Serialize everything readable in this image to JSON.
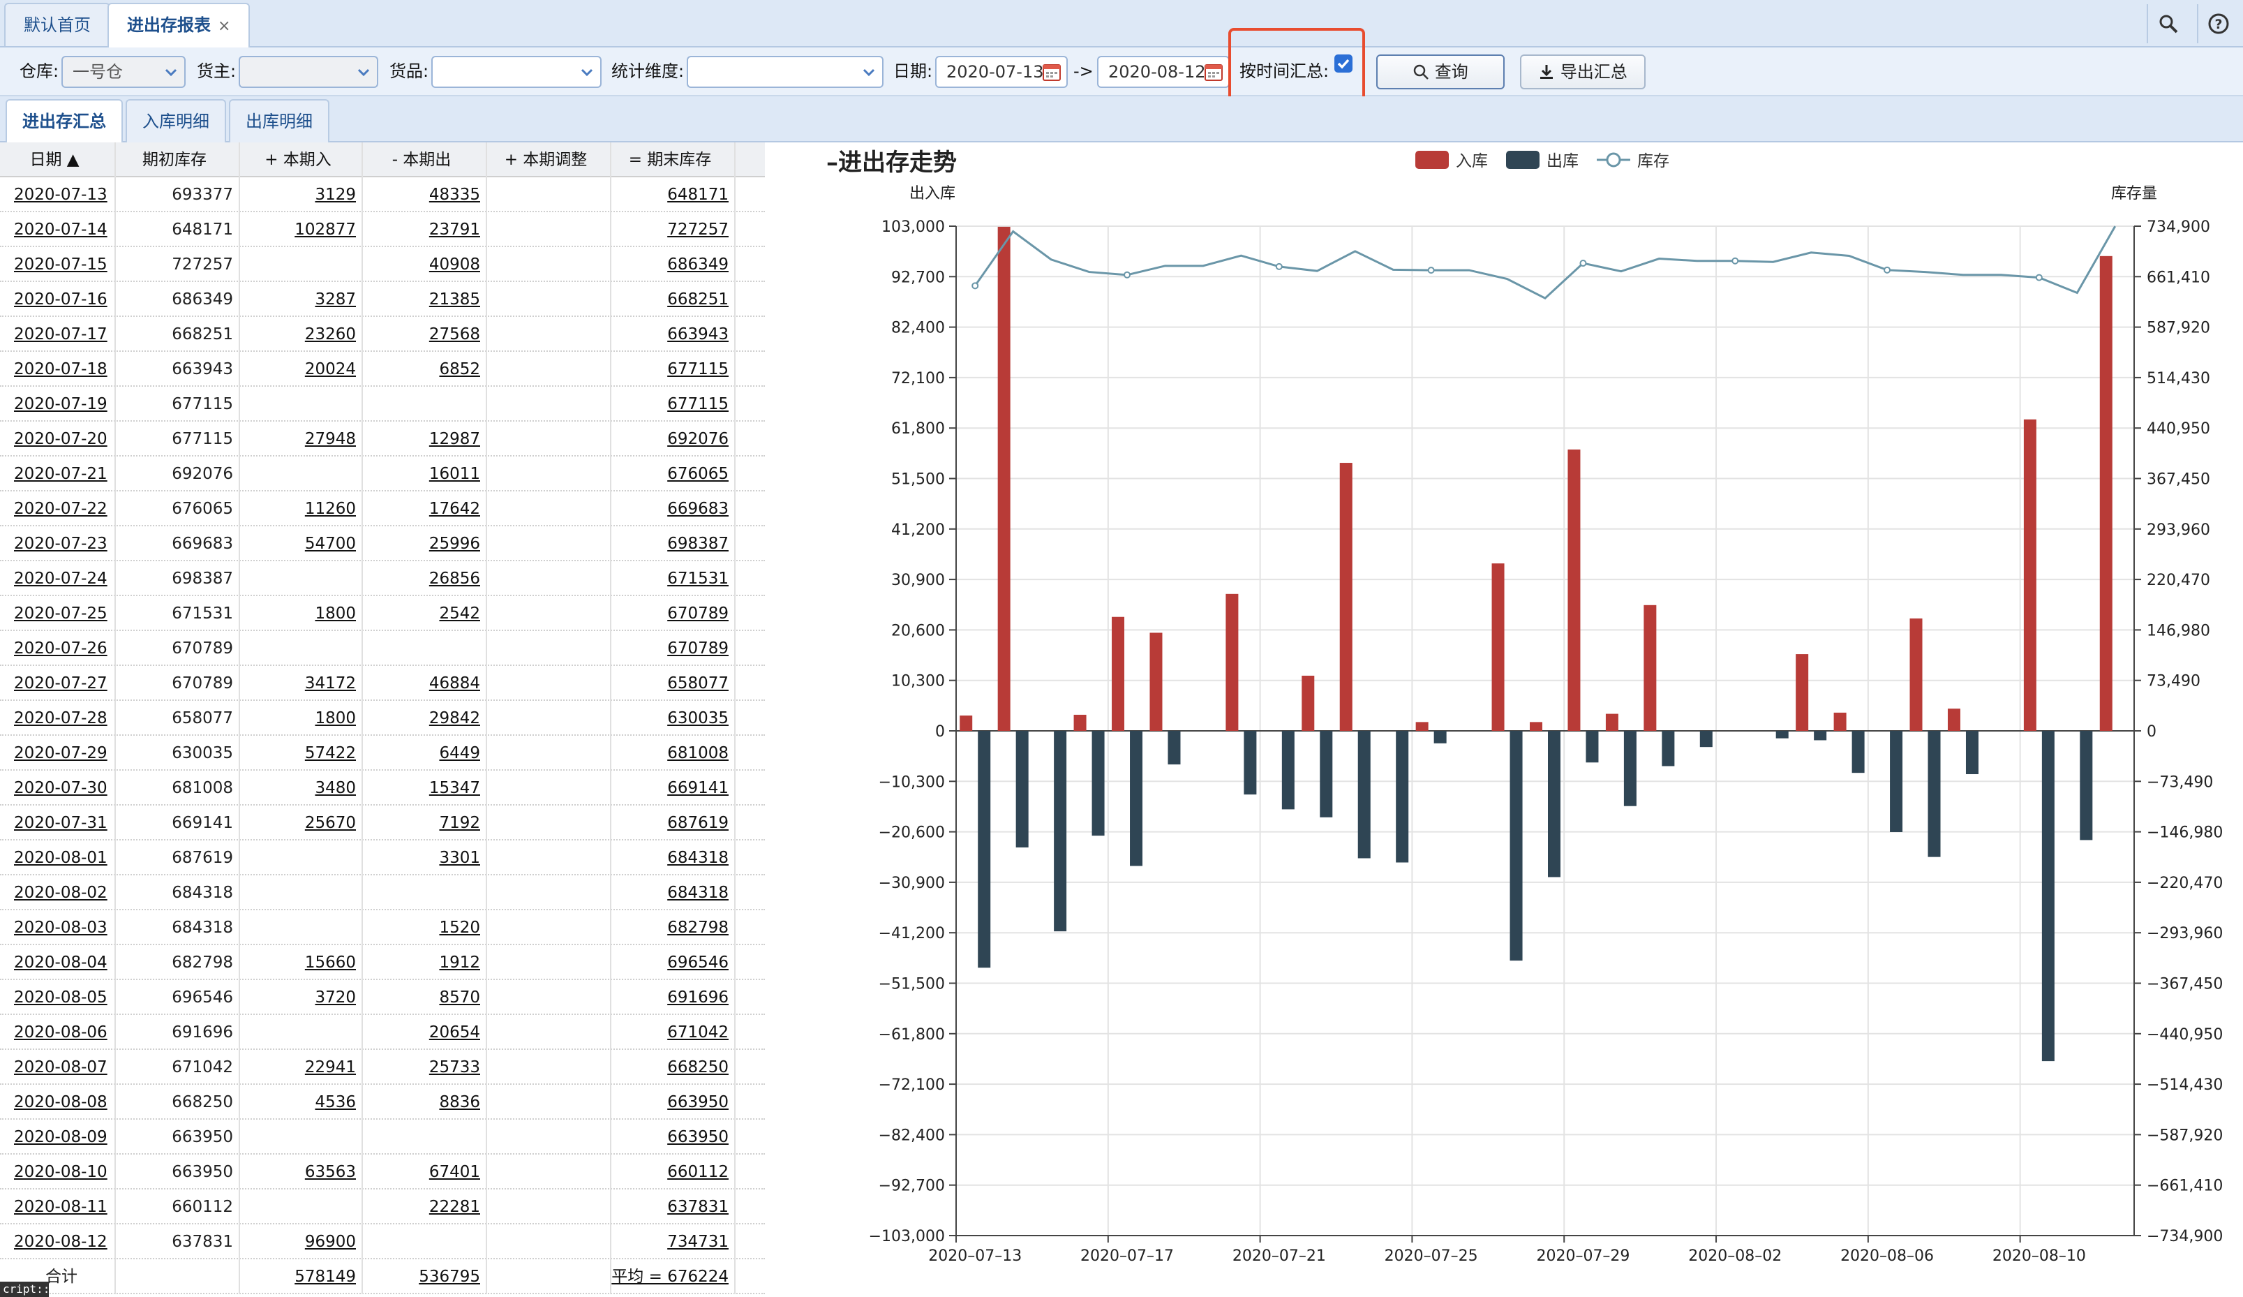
{
  "tabs": {
    "home": "默认首页",
    "report": "进出存报表",
    "close": "×"
  },
  "filters": {
    "warehouse_label": "仓库:",
    "warehouse_value": "一号仓",
    "owner_label": "货主:",
    "owner_value": "",
    "goods_label": "货品:",
    "goods_value": "",
    "dimension_label": "统计维度:",
    "dimension_value": "",
    "date_label": "日期:",
    "date_from": "2020-07-13",
    "arrow": "->",
    "date_to": "2020-08-12",
    "time_summary_label": "按时间汇总:",
    "time_summary_checked": true,
    "query_button": "查询",
    "export_button": "导出汇总"
  },
  "subtabs": [
    "进出存汇总",
    "入库明细",
    "出库明细"
  ],
  "table": {
    "headers": [
      "日期 ▲",
      "期初库存",
      "+ 本期入",
      "- 本期出",
      "+ 本期调整",
      "= 期末库存"
    ],
    "rows": [
      [
        "2020-07-13",
        "693377",
        "3129",
        "48335",
        "",
        "648171"
      ],
      [
        "2020-07-14",
        "648171",
        "102877",
        "23791",
        "",
        "727257"
      ],
      [
        "2020-07-15",
        "727257",
        "",
        "40908",
        "",
        "686349"
      ],
      [
        "2020-07-16",
        "686349",
        "3287",
        "21385",
        "",
        "668251"
      ],
      [
        "2020-07-17",
        "668251",
        "23260",
        "27568",
        "",
        "663943"
      ],
      [
        "2020-07-18",
        "663943",
        "20024",
        "6852",
        "",
        "677115"
      ],
      [
        "2020-07-19",
        "677115",
        "",
        "",
        "",
        "677115"
      ],
      [
        "2020-07-20",
        "677115",
        "27948",
        "12987",
        "",
        "692076"
      ],
      [
        "2020-07-21",
        "692076",
        "",
        "16011",
        "",
        "676065"
      ],
      [
        "2020-07-22",
        "676065",
        "11260",
        "17642",
        "",
        "669683"
      ],
      [
        "2020-07-23",
        "669683",
        "54700",
        "25996",
        "",
        "698387"
      ],
      [
        "2020-07-24",
        "698387",
        "",
        "26856",
        "",
        "671531"
      ],
      [
        "2020-07-25",
        "671531",
        "1800",
        "2542",
        "",
        "670789"
      ],
      [
        "2020-07-26",
        "670789",
        "",
        "",
        "",
        "670789"
      ],
      [
        "2020-07-27",
        "670789",
        "34172",
        "46884",
        "",
        "658077"
      ],
      [
        "2020-07-28",
        "658077",
        "1800",
        "29842",
        "",
        "630035"
      ],
      [
        "2020-07-29",
        "630035",
        "57422",
        "6449",
        "",
        "681008"
      ],
      [
        "2020-07-30",
        "681008",
        "3480",
        "15347",
        "",
        "669141"
      ],
      [
        "2020-07-31",
        "669141",
        "25670",
        "7192",
        "",
        "687619"
      ],
      [
        "2020-08-01",
        "687619",
        "",
        "3301",
        "",
        "684318"
      ],
      [
        "2020-08-02",
        "684318",
        "",
        "",
        "",
        "684318"
      ],
      [
        "2020-08-03",
        "684318",
        "",
        "1520",
        "",
        "682798"
      ],
      [
        "2020-08-04",
        "682798",
        "15660",
        "1912",
        "",
        "696546"
      ],
      [
        "2020-08-05",
        "696546",
        "3720",
        "8570",
        "",
        "691696"
      ],
      [
        "2020-08-06",
        "691696",
        "",
        "20654",
        "",
        "671042"
      ],
      [
        "2020-08-07",
        "671042",
        "22941",
        "25733",
        "",
        "668250"
      ],
      [
        "2020-08-08",
        "668250",
        "4536",
        "8836",
        "",
        "663950"
      ],
      [
        "2020-08-09",
        "663950",
        "",
        "",
        "",
        "663950"
      ],
      [
        "2020-08-10",
        "663950",
        "63563",
        "67401",
        "",
        "660112"
      ],
      [
        "2020-08-11",
        "660112",
        "",
        "22281",
        "",
        "637831"
      ],
      [
        "2020-08-12",
        "637831",
        "96900",
        "",
        "",
        "734731"
      ]
    ],
    "total": [
      "合计",
      "",
      "578149",
      "536795",
      "",
      "平均 = 676224"
    ]
  },
  "chart_data": {
    "type": "bar",
    "title": "进出存走势",
    "title_prefix": "–",
    "ylabel_left": "出入库",
    "ylabel_right": "库存量",
    "legend": [
      "入库",
      "出库",
      "库存"
    ],
    "legend_placement": "top-center",
    "categories": [
      "2020-07-13",
      "2020-07-14",
      "2020-07-15",
      "2020-07-16",
      "2020-07-17",
      "2020-07-18",
      "2020-07-19",
      "2020-07-20",
      "2020-07-21",
      "2020-07-22",
      "2020-07-23",
      "2020-07-24",
      "2020-07-25",
      "2020-07-26",
      "2020-07-27",
      "2020-07-28",
      "2020-07-29",
      "2020-07-30",
      "2020-07-31",
      "2020-08-01",
      "2020-08-02",
      "2020-08-03",
      "2020-08-04",
      "2020-08-05",
      "2020-08-06",
      "2020-08-07",
      "2020-08-08",
      "2020-08-09",
      "2020-08-10",
      "2020-08-11",
      "2020-08-12"
    ],
    "xtick_labels": [
      "2020–07–13",
      "2020–07–17",
      "2020–07–21",
      "2020–07–25",
      "2020–07–29",
      "2020–08–02",
      "2020–08–06",
      "2020–08–10"
    ],
    "series": [
      {
        "name": "入库",
        "type": "bar",
        "color": "#b83b37",
        "values": [
          3129,
          102877,
          0,
          3287,
          23260,
          20024,
          0,
          27948,
          0,
          11260,
          54700,
          0,
          1800,
          0,
          34172,
          1800,
          57422,
          3480,
          25670,
          0,
          0,
          0,
          15660,
          3720,
          0,
          22941,
          4536,
          0,
          63563,
          0,
          96900
        ]
      },
      {
        "name": "出库",
        "type": "bar",
        "color": "#2f4554",
        "values": [
          -48335,
          -23791,
          -40908,
          -21385,
          -27568,
          -6852,
          0,
          -12987,
          -16011,
          -17642,
          -25996,
          -26856,
          -2542,
          0,
          -46884,
          -29842,
          -6449,
          -15347,
          -7192,
          -3301,
          0,
          -1520,
          -1912,
          -8570,
          -20654,
          -25733,
          -8836,
          0,
          -67401,
          -22281,
          0
        ]
      },
      {
        "name": "库存",
        "type": "line",
        "color": "#6a96a8",
        "values": [
          648171,
          727257,
          686349,
          668251,
          663943,
          677115,
          677115,
          692076,
          676065,
          669683,
          698387,
          671531,
          670789,
          670789,
          658077,
          630035,
          681008,
          669141,
          687619,
          684318,
          684318,
          682798,
          696546,
          691696,
          671042,
          668250,
          663950,
          663950,
          660112,
          637831,
          734731
        ]
      }
    ],
    "ylim_left": [
      -103000,
      103000
    ],
    "ylim_right": [
      -734900,
      734900
    ],
    "yticks_left": [
      "103,000",
      "92,700",
      "82,400",
      "72,100",
      "61,800",
      "51,500",
      "41,200",
      "30,900",
      "20,600",
      "10,300",
      "0",
      "−10,300",
      "−20,600",
      "−30,900",
      "−41,200",
      "−51,500",
      "−61,800",
      "−72,100",
      "−82,400",
      "−92,700",
      "−103,000"
    ],
    "yticks_right": [
      "734,900",
      "661,410",
      "587,920",
      "514,430",
      "440,950",
      "367,450",
      "293,960",
      "220,470",
      "146,980",
      "73,490",
      "0",
      "−73,490",
      "−146,980",
      "−220,470",
      "−293,960",
      "−367,450",
      "−440,950",
      "−514,430",
      "−587,920",
      "−661,410",
      "−734,900"
    ],
    "grid": true
  },
  "overlay_text": "cript::"
}
